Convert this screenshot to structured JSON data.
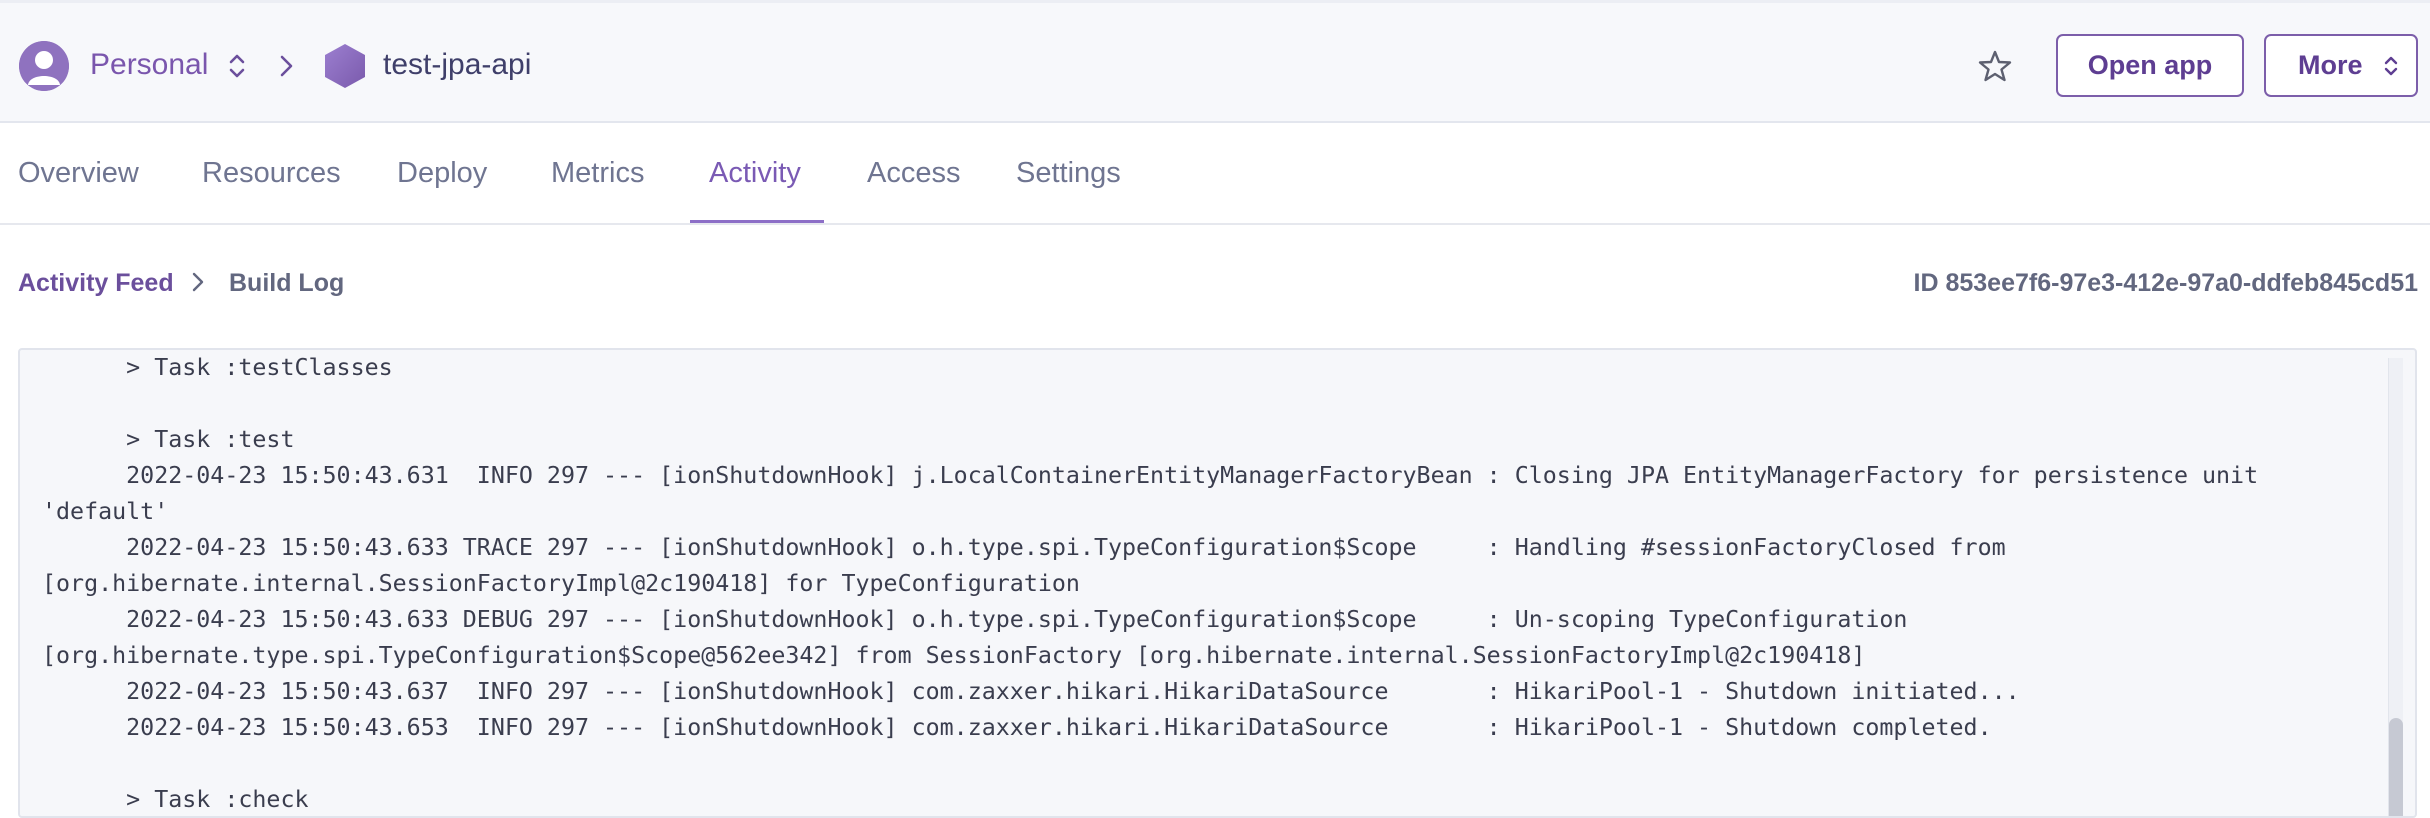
{
  "header": {
    "account_label": "Personal",
    "app_name": "test-jpa-api",
    "open_app_label": "Open app",
    "more_label": "More"
  },
  "tabs": [
    {
      "label": "Overview",
      "active": false
    },
    {
      "label": "Resources",
      "active": false
    },
    {
      "label": "Deploy",
      "active": false
    },
    {
      "label": "Metrics",
      "active": false
    },
    {
      "label": "Activity",
      "active": true
    },
    {
      "label": "Access",
      "active": false
    },
    {
      "label": "Settings",
      "active": false
    }
  ],
  "breadcrumb": {
    "feed_label": "Activity Feed",
    "current_label": "Build Log",
    "build_id": "ID 853ee7f6-97e3-412e-97a0-ddfeb845cd51"
  },
  "log": {
    "text": "      > Task :testClasses\n\n      > Task :test\n      2022-04-23 15:50:43.631  INFO 297 --- [ionShutdownHook] j.LocalContainerEntityManagerFactoryBean : Closing JPA EntityManagerFactory for persistence unit\n'default'\n      2022-04-23 15:50:43.633 TRACE 297 --- [ionShutdownHook] o.h.type.spi.TypeConfiguration$Scope     : Handling #sessionFactoryClosed from\n[org.hibernate.internal.SessionFactoryImpl@2c190418] for TypeConfiguration\n      2022-04-23 15:50:43.633 DEBUG 297 --- [ionShutdownHook] o.h.type.spi.TypeConfiguration$Scope     : Un-scoping TypeConfiguration\n[org.hibernate.type.spi.TypeConfiguration$Scope@562ee342] from SessionFactory [org.hibernate.internal.SessionFactoryImpl@2c190418]\n      2022-04-23 15:50:43.637  INFO 297 --- [ionShutdownHook] com.zaxxer.hikari.HikariDataSource       : HikariPool-1 - Shutdown initiated...\n      2022-04-23 15:50:43.653  INFO 297 --- [ionShutdownHook] com.zaxxer.hikari.HikariDataSource       : HikariPool-1 - Shutdown completed.\n\n      > Task :check"
  },
  "colors": {
    "brand_purple": "#7a56ad",
    "active_tab": "#7a5ab4",
    "muted_text": "#6f7591"
  },
  "icons": {
    "avatar": "user-avatar-icon",
    "account_switch": "chevron-up-down-icon",
    "breadcrumb_separator": "chevron-right-icon",
    "app": "hexagon-app-icon",
    "favorite": "star-icon"
  }
}
